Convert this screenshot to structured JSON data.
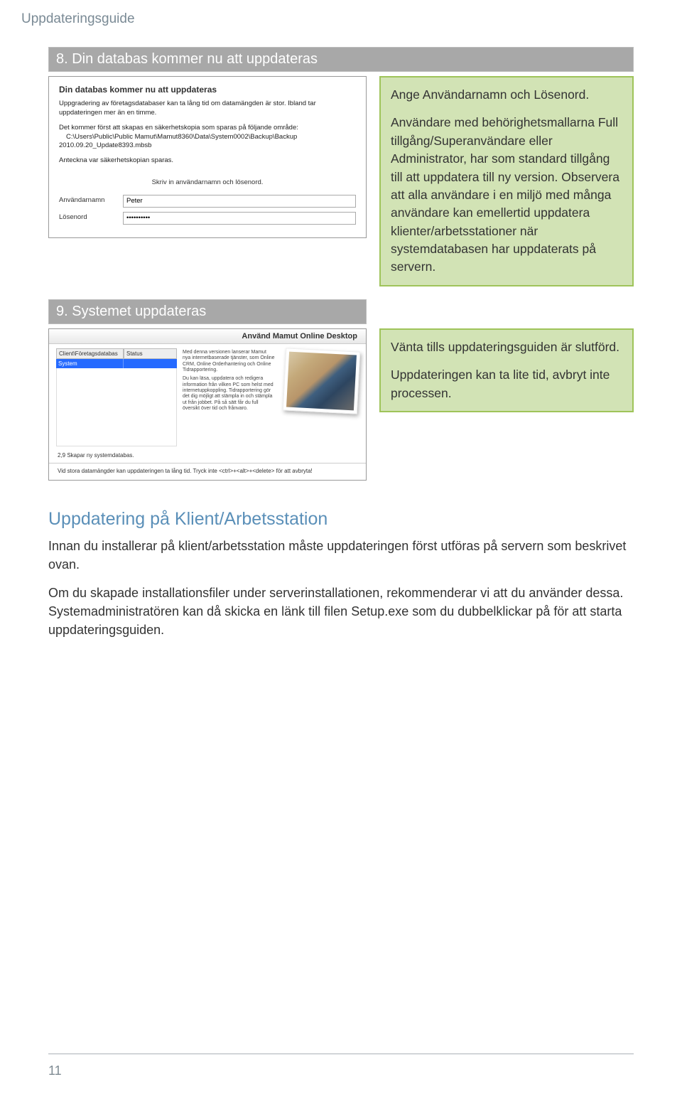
{
  "header": {
    "title": "Uppdateringsguide"
  },
  "step8": {
    "bar": "8. Din databas kommer nu att uppdateras",
    "dialog": {
      "title": "Din databas kommer nu att uppdateras",
      "p1": "Uppgradering av företagsdatabaser kan ta lång tid om datamängden är stor. Ibland tar uppdateringen mer än en timme.",
      "p2": "Det kommer först att skapas en säkerhetskopia som sparas på följande område:",
      "path": "C:\\Users\\Public\\Public Mamut\\Mamut8360\\Data\\System0002\\Backup\\Backup 2010.09.20_Update8393.mbsb",
      "p3": "Anteckna var säkerhetskopian sparas.",
      "subtitle": "Skriv in användarnamn och lösenord.",
      "label_user": "Användarnamn",
      "label_pass": "Lösenord",
      "value_user": "Peter",
      "value_pass": "••••••••••"
    },
    "callout": {
      "p1": "Ange Användarnamn och Lösenord.",
      "p2": "Användare med behörighetsmallarna Full tillgång/Superanvändare eller Administrator, har som standard tillgång till att uppdatera till ny version. Observera att alla användare i en miljö med många användare kan emellertid uppdatera klienter/arbetsstationer när systemdatabasen har uppdaterats på servern."
    }
  },
  "step9": {
    "bar": "9. Systemet uppdateras",
    "dialog": {
      "header": "Använd Mamut Online Desktop",
      "mid_p1": "Med denna versionen lanserar Mamut nya internetbaserade tjänster, som Online CRM, Online Orderhantering och Online Tidrapportering.",
      "mid_p2": "Du kan läsa, uppdatera och redigera information från vilken PC som helst med internetuppkoppling. Tidrapportering gör det dig möjligt att stämpla in och stämpla ut från jobbet. På så sätt får du full översikt över tid och frånvaro.",
      "table": {
        "col1": "Client\\Företagsdatabas",
        "col2": "Status",
        "row1_col1": "System"
      },
      "progress": "2,9 Skapar ny systemdatabas.",
      "footer": "Vid stora datamängder kan uppdateringen ta lång tid. Tryck inte <ctrl>+<alt>+<delete> för att avbryta!"
    },
    "callout1": {
      "p1": "Vänta tills uppdateringsguiden är slutförd.",
      "p2": "Uppdateringen kan ta lite tid, avbryt inte processen."
    }
  },
  "section": {
    "heading": "Uppdatering på Klient/Arbetsstation",
    "p1": "Innan du installerar på klient/arbetsstation måste uppdateringen först utföras på servern som beskrivet ovan.",
    "p2": "Om du skapade installationsfiler under serverinstallationen, rekommenderar vi att du använder dessa. Systemadministratören kan då skicka en länk till filen Setup.exe som du dubbelklickar på för att starta uppdateringsguiden."
  },
  "page_number": "11"
}
